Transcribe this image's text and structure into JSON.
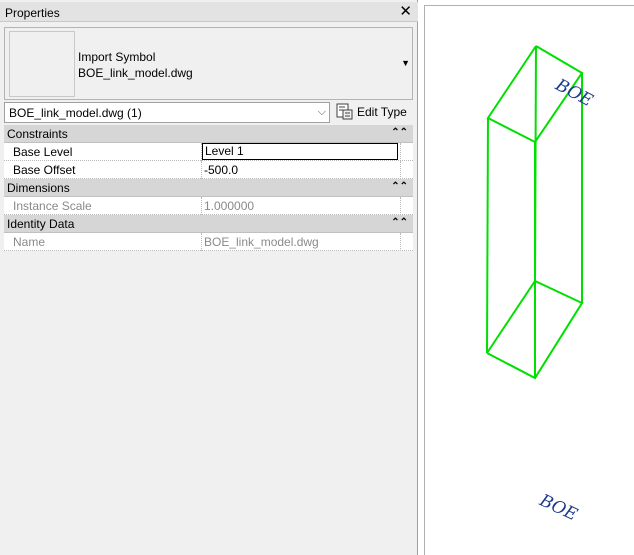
{
  "panel": {
    "title": "Properties",
    "close_glyph": "✕"
  },
  "type_selector": {
    "family": "Import Symbol",
    "type": "BOE_link_model.dwg"
  },
  "instance_selector": {
    "value": "BOE_link_model.dwg (1)"
  },
  "edit_type": {
    "label": "Edit Type",
    "icon": "edit-type-icon"
  },
  "properties": {
    "constraints": {
      "label": "Constraints",
      "base_level_label": "Base Level",
      "base_level_value": "Level 1",
      "base_offset_label": "Base Offset",
      "base_offset_value": "-500.0"
    },
    "dimensions": {
      "label": "Dimensions",
      "instance_scale_label": "Instance Scale",
      "instance_scale_value": "1.000000"
    },
    "identity": {
      "label": "Identity Data",
      "name_label": "Name",
      "name_value": "BOE_link_model.dwg"
    }
  },
  "canvas": {
    "text_top": "BOE",
    "text_bottom": "BOE",
    "model_color": "#00e000",
    "text_color": "#1a3a8a"
  }
}
